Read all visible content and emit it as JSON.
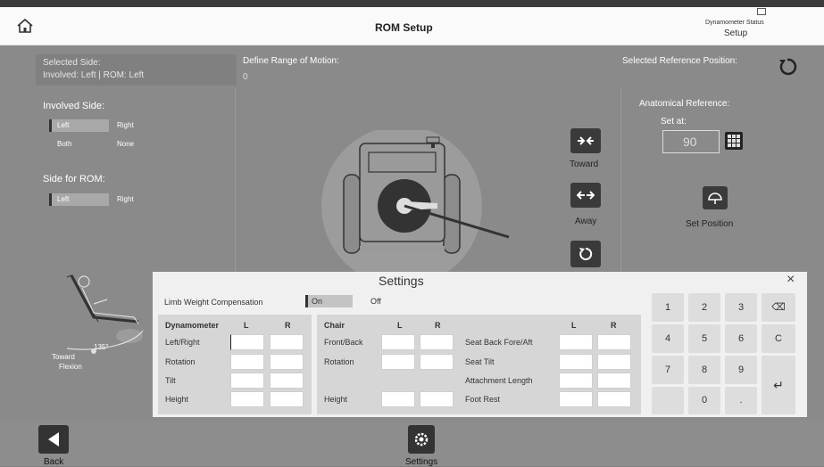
{
  "header": {
    "title": "ROM Setup",
    "status_label": "Dynamometer Status",
    "status_value": "Setup"
  },
  "left": {
    "selected_side_label": "Selected Side:",
    "selected_side_value": "Involved: Left | ROM: Left",
    "involved_title": "Involved Side:",
    "involved_opts": [
      "Left",
      "Right",
      "Both",
      "None"
    ],
    "rom_title": "Side for ROM:",
    "rom_opts": [
      "Left",
      "Right"
    ]
  },
  "center": {
    "define_label": "Define Range of Motion:",
    "define_value": "0",
    "toward": "Toward",
    "away": "Away"
  },
  "right": {
    "ref_label": "Selected Reference Position:",
    "anat_label": "Anatomical Reference:",
    "set_at": "Set at:",
    "set_value": "90",
    "set_position": "Set Position"
  },
  "patient": {
    "angle": "135°",
    "direction": "Toward",
    "motion": "Flexion"
  },
  "settings": {
    "title": "Settings",
    "lwc_label": "Limb Weight Compensation",
    "on": "On",
    "off": "Off",
    "dyn_header": "Dynamometer",
    "chair_header": "Chair",
    "L": "L",
    "R": "R",
    "dyn_rows": [
      "Left/Right",
      "Rotation",
      "Tilt",
      "Height"
    ],
    "chair_rows": [
      "Front/Back",
      "Rotation",
      "",
      "Height"
    ],
    "chair2_rows": [
      "Seat Back Fore/Aft",
      "Seat Tilt",
      "Attachment Length",
      "Foot Rest"
    ]
  },
  "keypad": {
    "keys": [
      "1",
      "2",
      "3",
      "4",
      "5",
      "6",
      "7",
      "8",
      "9",
      "0",
      "."
    ],
    "close": "×",
    "backspace": "⌫",
    "clear": "C",
    "enter": "↵"
  },
  "footer": {
    "back": "Back",
    "settings": "Settings"
  },
  "colors": {
    "dark": "#3a3a3a",
    "overlay": "#8a8a8a"
  }
}
